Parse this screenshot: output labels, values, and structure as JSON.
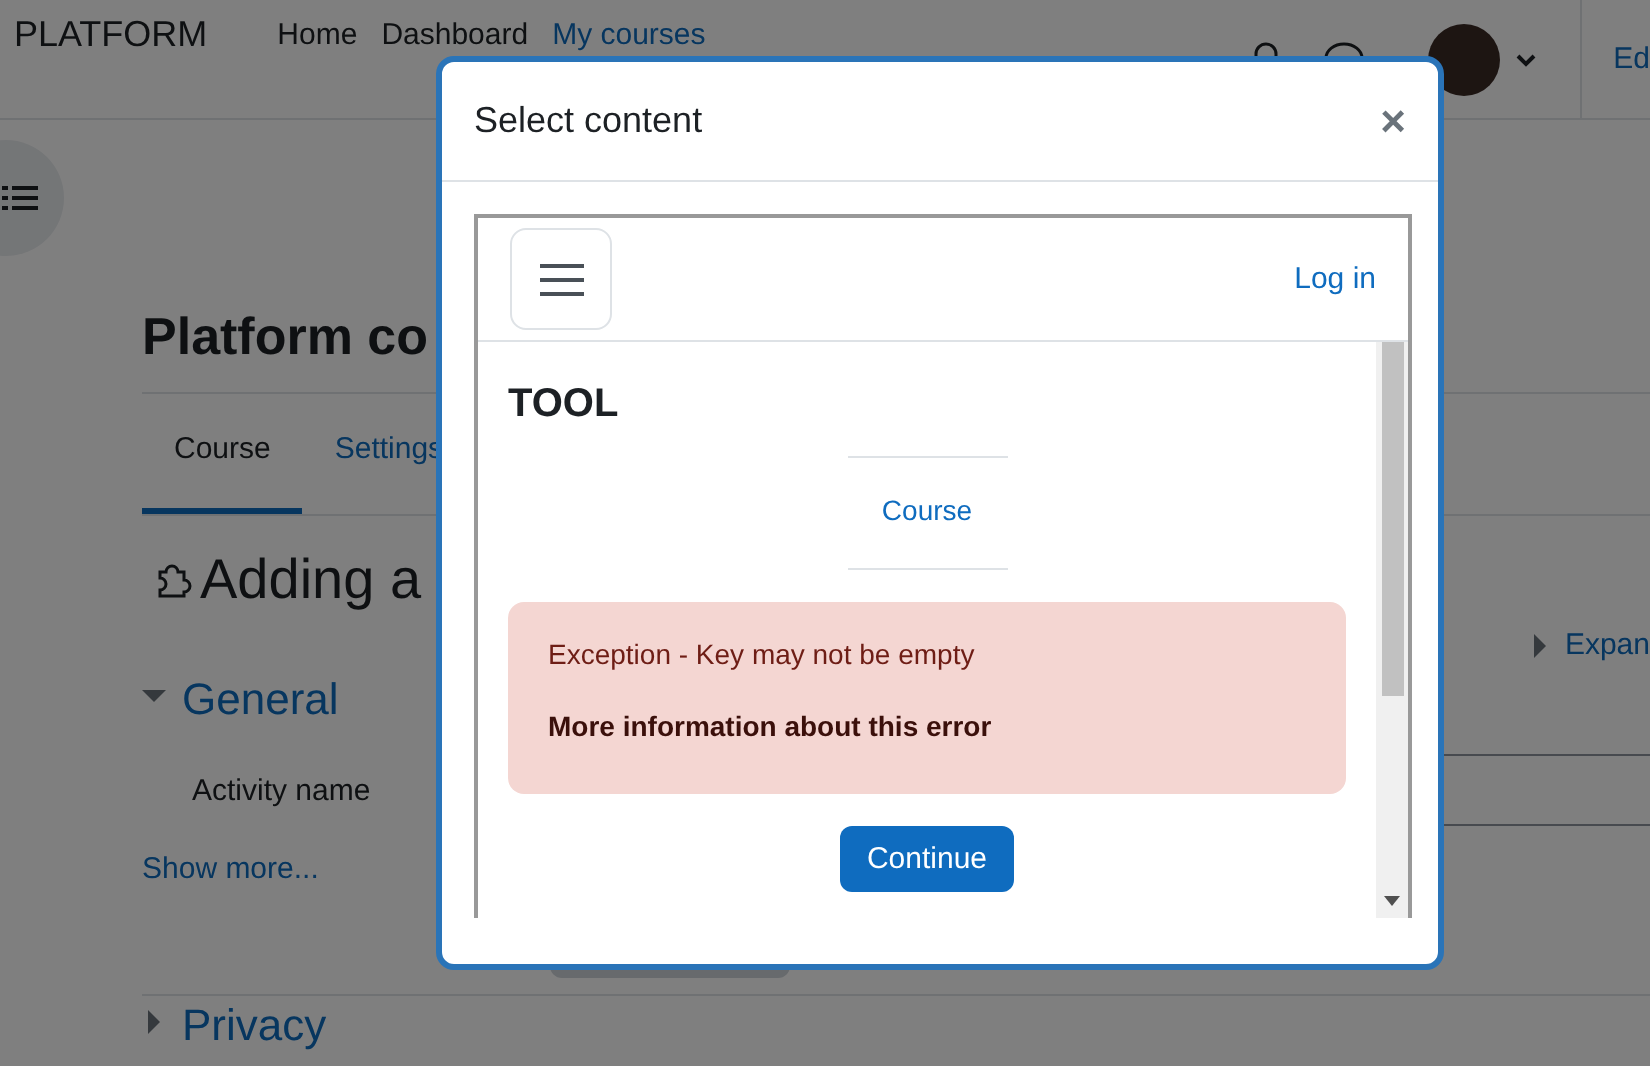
{
  "navbar": {
    "brand": "PLATFORM",
    "links": [
      {
        "label": "Home"
      },
      {
        "label": "Dashboard"
      },
      {
        "label": "My courses"
      }
    ],
    "edit_label": "Ed"
  },
  "page": {
    "title": "Platform co",
    "tabs": [
      {
        "label": "Course",
        "selected": true
      },
      {
        "label": "Settings",
        "selected": false
      }
    ],
    "heading": "Adding a",
    "expand_label": "Expan",
    "sections": [
      {
        "title": "General",
        "expanded": true,
        "field_label": "Activity name",
        "show_more": "Show more..."
      },
      {
        "title": "Privacy",
        "expanded": false
      }
    ]
  },
  "modal": {
    "title": "Select content",
    "close": "×",
    "frame": {
      "login": "Log in",
      "heading": "TOOL",
      "nav_item": "Course",
      "alert": {
        "message": "Exception - Key may not be empty",
        "link": "More information about this error"
      },
      "button": "Continue"
    }
  }
}
